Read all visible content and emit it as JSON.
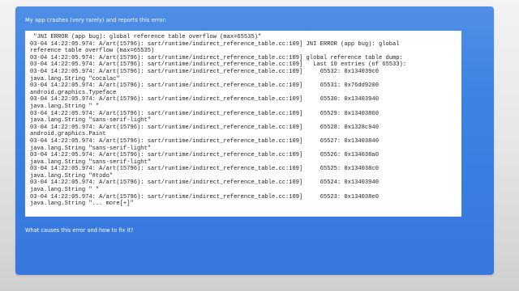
{
  "post": {
    "intro": "My app crashes (very rarely) and reports this error:",
    "question": "What causes this error and how to fix it?"
  },
  "code_block": {
    "lines": [
      " \"JNI ERROR (app bug): global reference table overflow (max=65535)\"",
      "03-04 14:22:05.974: A/art(15796): sart/runtime/indirect_reference_table.cc:109] JNI ERROR (app bug): global",
      "reference table overflow (max=65535)",
      "03-04 14:22:05.974: A/art(15796): sart/runtime/indirect_reference_table.cc:109] global reference table dump:",
      "03-04 14:22:05.974: A/art(15796): sart/runtime/indirect_reference_table.cc:109]   Last 10 entries (of 65533):",
      "03-04 14:22:05.974: A/art(15796): sart/runtime/indirect_reference_table.cc:109]     65532: 0x134039c0",
      "java.lang.String \"cocalac\"",
      "03-04 14:22:05.974: A/art(15796): sart/runtime/indirect_reference_table.cc:109]     65531: 0x76dd9200",
      "android.graphics.Typeface",
      "03-04 14:22:05.974: A/art(15796): sart/runtime/indirect_reference_table.cc:109]     65530: 0x13403940",
      "java.lang.String \" \"",
      "03-04 14:22:05.974: A/art(15796): sart/runtime/indirect_reference_table.cc:109]     65529: 0x13403860",
      "java.lang.String \"sans-serif-light\"",
      "03-04 14:22:05.974: A/art(15796): sart/runtime/indirect_reference_table.cc:109]     65528: 0x1328c940",
      "android.graphics.Paint",
      "03-04 14:22:05.974: A/art(15796): sart/runtime/indirect_reference_table.cc:109]     65527: 0x13403840",
      "java.lang.String \"sans-serif-light\"",
      "03-04 14:22:05.974: A/art(15796): sart/runtime/indirect_reference_table.cc:109]     65526: 0x134038a0",
      "java.lang.String \"sans-serif-light\"",
      "03-04 14:22:05.974: A/art(15796): sart/runtime/indirect_reference_table.cc:109]     65525: 0x134038c0",
      "java.lang.String \"#todo\"",
      "03-04 14:22:05.974: A/art(15796): sart/runtime/indirect_reference_table.cc:109]     65524: 0x13403940",
      "java.lang.String \" \"",
      "03-04 14:22:05.974: A/art(15796): sart/runtime/indirect_reference_table.cc:109]     65523: 0x134038e0",
      "java.lang.String \"... more[+]\""
    ]
  },
  "colors": {
    "card_top": "#4f8ee6",
    "card_bottom": "#3777de",
    "code_bg": "#ffffff",
    "code_text": "#222222"
  }
}
